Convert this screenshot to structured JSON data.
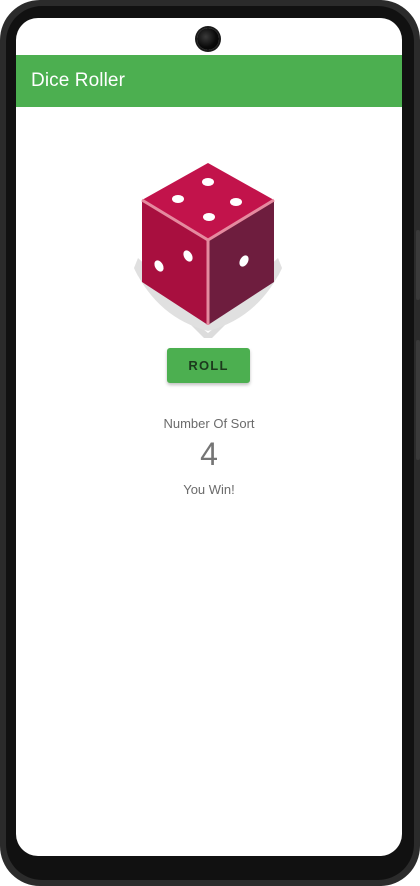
{
  "app_bar": {
    "title": "Dice Roller",
    "color": "#4caf50"
  },
  "dice": {
    "icon": "dice-icon",
    "face_color": "#c2134b"
  },
  "roll_button": {
    "label": "ROLL"
  },
  "result": {
    "caption": "Number Of Sort",
    "value": "4",
    "message": "You Win!"
  }
}
